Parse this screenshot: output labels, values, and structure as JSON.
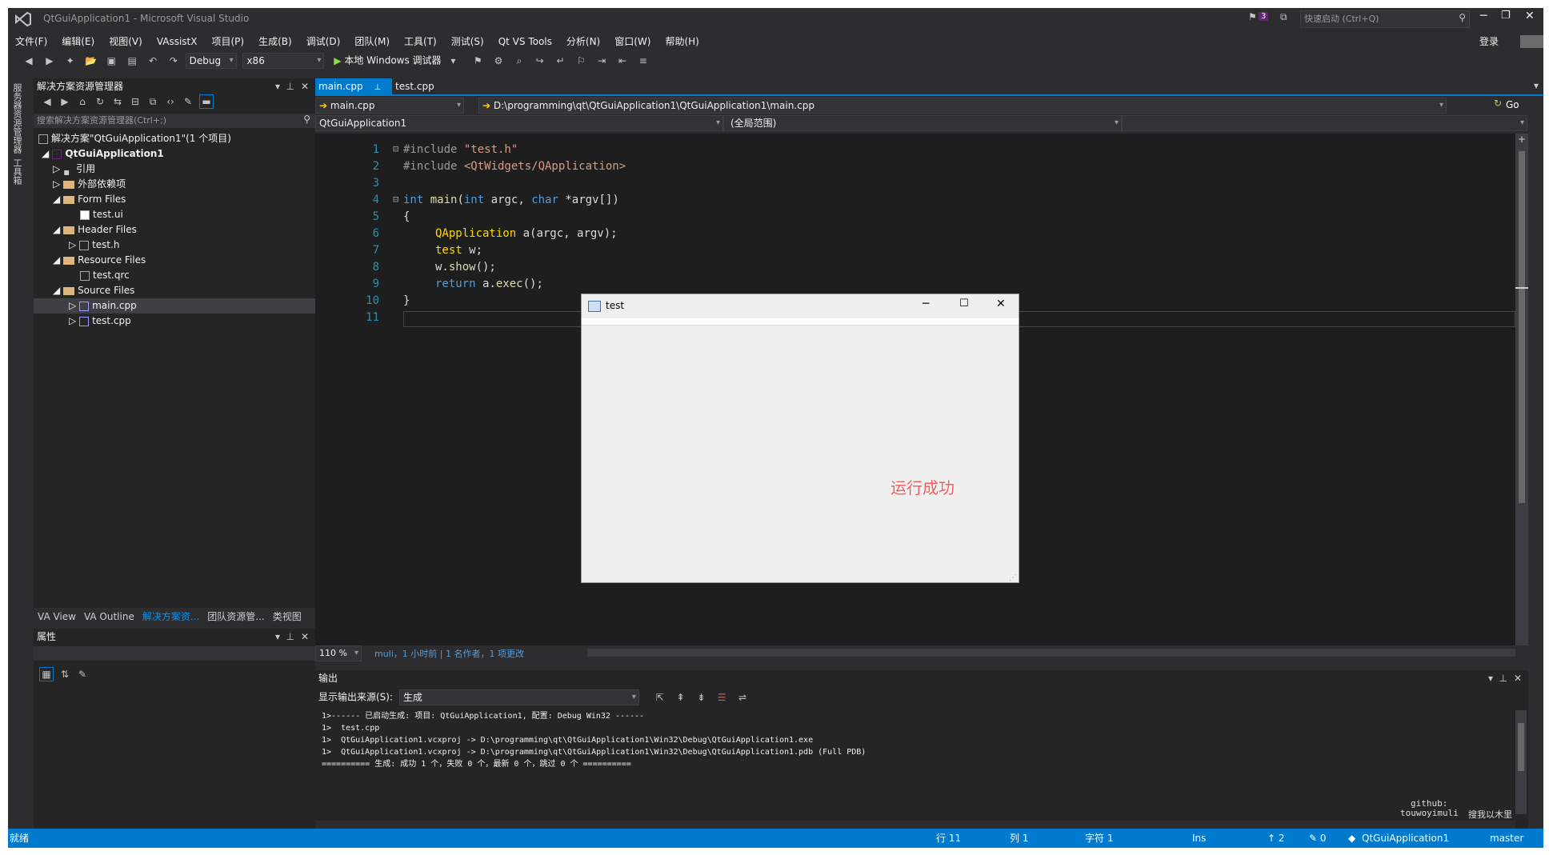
{
  "window": {
    "title": "QtGuiApplication1 - Microsoft Visual Studio",
    "filter_count": "3",
    "quick_launch_placeholder": "快速启动 (Ctrl+Q)",
    "login": "登录"
  },
  "menu": [
    "文件(F)",
    "编辑(E)",
    "视图(V)",
    "VAssistX",
    "项目(P)",
    "生成(B)",
    "调试(D)",
    "团队(M)",
    "工具(T)",
    "测试(S)",
    "Qt VS Tools",
    "分析(N)",
    "窗口(W)",
    "帮助(H)"
  ],
  "toolbar": {
    "config": "Debug",
    "platform": "x86",
    "run_label": "本地 Windows 调试器"
  },
  "left_tabs": [
    "服务器资源管理器",
    "工具箱"
  ],
  "solution_explorer": {
    "title": "解决方案资源管理器",
    "search_placeholder": "搜索解决方案资源管理器(Ctrl+;)",
    "items": [
      {
        "label": "解决方案\"QtGuiApplication1\"(1 个项目)",
        "level": 0,
        "kind": "solution"
      },
      {
        "label": "QtGuiApplication1",
        "level": 1,
        "kind": "project",
        "expander": "◢"
      },
      {
        "label": "引用",
        "level": 2,
        "kind": "ref",
        "expander": "▷"
      },
      {
        "label": "外部依赖项",
        "level": 2,
        "kind": "folder",
        "expander": "▷"
      },
      {
        "label": "Form Files",
        "level": 2,
        "kind": "folder",
        "expander": "◢"
      },
      {
        "label": "test.ui",
        "level": 3,
        "kind": "file"
      },
      {
        "label": "Header Files",
        "level": 2,
        "kind": "folder",
        "expander": "◢"
      },
      {
        "label": "test.h",
        "level": 3,
        "kind": "file",
        "expander": "▷"
      },
      {
        "label": "Resource Files",
        "level": 2,
        "kind": "folder",
        "expander": "◢"
      },
      {
        "label": "test.qrc",
        "level": 3,
        "kind": "file"
      },
      {
        "label": "Source Files",
        "level": 2,
        "kind": "folder",
        "expander": "◢"
      },
      {
        "label": "main.cpp",
        "level": 3,
        "kind": "cpp",
        "expander": "▷",
        "selected": true
      },
      {
        "label": "test.cpp",
        "level": 3,
        "kind": "cpp",
        "expander": "▷"
      }
    ]
  },
  "bottom_tabs": [
    "VA View",
    "VA Outline",
    "解决方案资...",
    "团队资源管...",
    "类视图"
  ],
  "properties": {
    "title": "属性"
  },
  "editor": {
    "tabs": [
      "main.cpp",
      "test.cpp"
    ],
    "nav_file": "main.cpp",
    "nav_path": "D:\\programming\\qt\\QtGuiApplication1\\QtGuiApplication1\\main.cpp",
    "go": "Go",
    "scope_project": "QtGuiApplication1",
    "scope": "(全局范围)",
    "line_numbers": [
      "1",
      "2",
      "3",
      "4",
      "5",
      "6",
      "7",
      "8",
      "9",
      "10",
      "11"
    ],
    "zoom": "110 %",
    "codelens": "muli，1 小时前 | 1 名作者，1 项更改"
  },
  "code": {
    "l1a": "#include ",
    "l1b": "\"test.h\"",
    "l2a": "#include ",
    "l2b": "<QtWidgets/QApplication>",
    "l4a": "int ",
    "l4b": "main",
    "l4c": "(",
    "l4d": "int",
    "l4e": " argc, ",
    "l4f": "char",
    "l4g": " *argv[])",
    "l5": "{",
    "l6a": "QApplication",
    "l6b": " a(argc, argv);",
    "l7a": "test",
    "l7b": " w;",
    "l8a": "w.",
    "l8b": "show",
    "l8c": "();",
    "l9a": "return",
    "l9b": " a.",
    "l9c": "exec",
    "l9d": "();",
    "l10": "}"
  },
  "qt_window": {
    "title": "test",
    "annotation": "运行成功"
  },
  "output": {
    "title": "输出",
    "source_label": "显示输出来源(S):",
    "source_value": "生成",
    "lines": [
      "1>------ 已启动生成: 项目: QtGuiApplication1, 配置: Debug Win32 ------",
      "1>  test.cpp",
      "1>  QtGuiApplication1.vcxproj -> D:\\programming\\qt\\QtGuiApplication1\\Win32\\Debug\\QtGuiApplication1.exe",
      "1>  QtGuiApplication1.vcxproj -> D:\\programming\\qt\\QtGuiApplication1\\Win32\\Debug\\QtGuiApplication1.pdb (Full PDB)",
      "========== 生成: 成功 1 个，失败 0 个，最新 0 个，跳过 0 个 =========="
    ]
  },
  "status": {
    "ready": "就绪",
    "line": "行 11",
    "col": "列 1",
    "char": "字符 1",
    "ins": "Ins",
    "up": "↑ 2",
    "edits": "✎ 0",
    "repo": "QtGuiApplication1",
    "branch": "master"
  },
  "watermark": {
    "line1": "github:",
    "line2": "touwoyimuli",
    "line3": "搜我以木里"
  },
  "colors": {
    "accent": "#007acc",
    "background": "#2d2d30",
    "editor": "#1e1e1e"
  }
}
